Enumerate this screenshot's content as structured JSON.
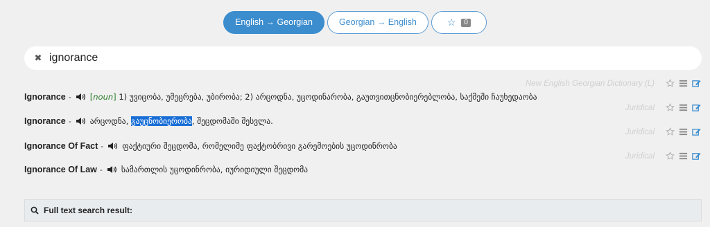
{
  "tabs": [
    {
      "label": "English → Georgian"
    },
    {
      "label": "Georgian → English"
    },
    {
      "label": "",
      "count": "0"
    }
  ],
  "search": {
    "value": "ignorance",
    "clear_icon": "close-icon"
  },
  "entries": [
    {
      "source": "New English Georgian Dictionary (L)",
      "word": "Ignorance",
      "dash": "-",
      "pos_open": "[",
      "pos": "noun",
      "pos_close": "]",
      "definition": "1) უვიცობა, უმეცრება, უბირობა; 2) არცოდნა, უცოდინარობა, გაუთვითცნობიერებლობა, საქმეში ჩაუხედაობა"
    },
    {
      "source": "Juridical",
      "word": "Ignorance",
      "dash": "-",
      "def_before": "არცოდნა, ",
      "def_highlight": "გაუცნობიერობა",
      "def_after": ", შეცდომაში შესვლა."
    },
    {
      "source": "Juridical",
      "word": "Ignorance Of Fact",
      "dash": "-",
      "definition": "ფაქტიური შეცდომა, რომელიმე ფაქტობრივი გარემოების უცოდინრობა"
    },
    {
      "source": "Juridical",
      "word": "Ignorance Of Law",
      "dash": "-",
      "definition": "სამართლის უცოდინრობა, იურიდიული შეცდომა"
    }
  ],
  "fulltext": {
    "label": "Full text search result:"
  },
  "colors": {
    "accent": "#3c8dce",
    "pos": "#2a7a2a",
    "highlight": "#1a6fd6"
  }
}
